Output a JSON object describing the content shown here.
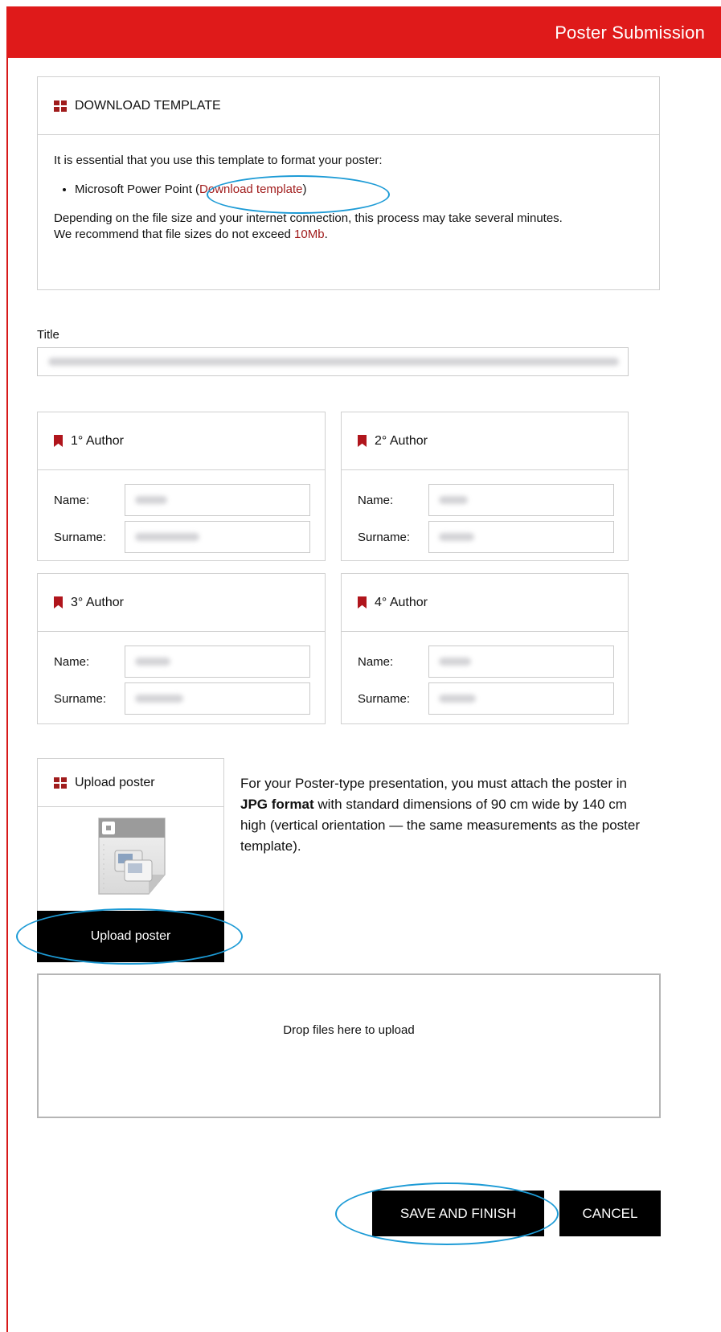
{
  "header": {
    "title": "Poster Submission"
  },
  "download_panel": {
    "heading": "DOWNLOAD TEMPLATE",
    "intro": "It is essential that you use this template to format your poster:",
    "item_prefix": "Microsoft Power Point (",
    "item_link": "Download template",
    "item_suffix": ")",
    "note_line": "Depending on the file size and your internet connection, this process may take several minutes.",
    "recommend_prefix": "We recommend that file sizes do not exceed ",
    "recommend_size": "10Mb",
    "recommend_suffix": "."
  },
  "title_field": {
    "label": "Title",
    "value": ""
  },
  "authors": [
    {
      "heading": "1° Author",
      "name_label": "Name:",
      "surname_label": "Surname:"
    },
    {
      "heading": "2° Author",
      "name_label": "Name:",
      "surname_label": "Surname:"
    },
    {
      "heading": "3° Author",
      "name_label": "Name:",
      "surname_label": "Surname:"
    },
    {
      "heading": "4° Author",
      "name_label": "Name:",
      "surname_label": "Surname:"
    }
  ],
  "upload": {
    "heading": "Upload poster",
    "button_label": "Upload poster",
    "desc_1": "For your Poster-type presentation, you must attach the poster in ",
    "desc_bold": "JPG format",
    "desc_2": " with standard dimensions of 90 cm wide by 140 cm high (vertical orientation — the same measurements as the poster template).",
    "dropzone_text": "Drop files here to upload"
  },
  "actions": {
    "save_label": "SAVE AND FINISH",
    "cancel_label": "CANCEL"
  },
  "colors": {
    "brand_red": "#df1a1a",
    "accent_red": "#a11d1d",
    "highlight_blue": "#1d9bd6"
  }
}
